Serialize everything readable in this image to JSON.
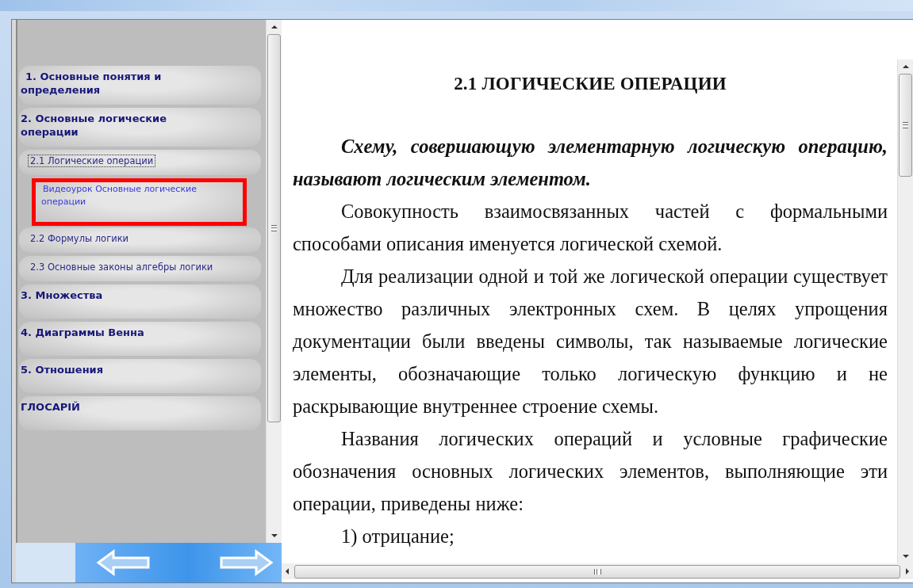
{
  "sidebar": {
    "items": [
      {
        "label": "1. Основные понятия и определения"
      },
      {
        "label": "2. Основные логические операции",
        "children": [
          {
            "label": "2.1 Логические операции",
            "marked": false,
            "focused": true,
            "kind": "topic"
          },
          {
            "label": "Видеоурок Основные логические операции",
            "marked": true,
            "focused": false,
            "kind": "video"
          },
          {
            "label": "2.2 Формулы логики",
            "marked": false,
            "focused": false,
            "kind": "topic"
          },
          {
            "label": "2.3 Основные законы алгебры логики",
            "marked": false,
            "focused": false,
            "kind": "topic"
          }
        ]
      },
      {
        "label": "3. Множества"
      },
      {
        "label": "4. Диаграммы Венна"
      },
      {
        "label": "5. Отношения"
      },
      {
        "label": "ГЛОСАРІЙ"
      }
    ]
  },
  "content": {
    "heading": "2.1  ЛОГИЧЕСКИЕ ОПЕРАЦИИ",
    "paragraphs": [
      {
        "kind": "emphasis",
        "text": "Схему, совершающую элементарную логическую операцию, называют логическим элементом."
      },
      {
        "kind": "plain",
        "text": "Совокупность взаимосвязанных частей с формальными способами описания именуется логической схемой."
      },
      {
        "kind": "plain",
        "text": "Для реализации одной и той же логической операции существует множество различных электронных схем. В целях упрощения документации были введены символы, так называемые логические элементы, обозначающие только логическую функцию и не раскрывающие внутреннее строение схемы."
      },
      {
        "kind": "plain",
        "text": "Названия логических операций и условные графические обозначения основных логических элементов, выполняющие эти операции, приведены ниже:"
      },
      {
        "kind": "list",
        "text": "1) отрицание;"
      }
    ]
  }
}
